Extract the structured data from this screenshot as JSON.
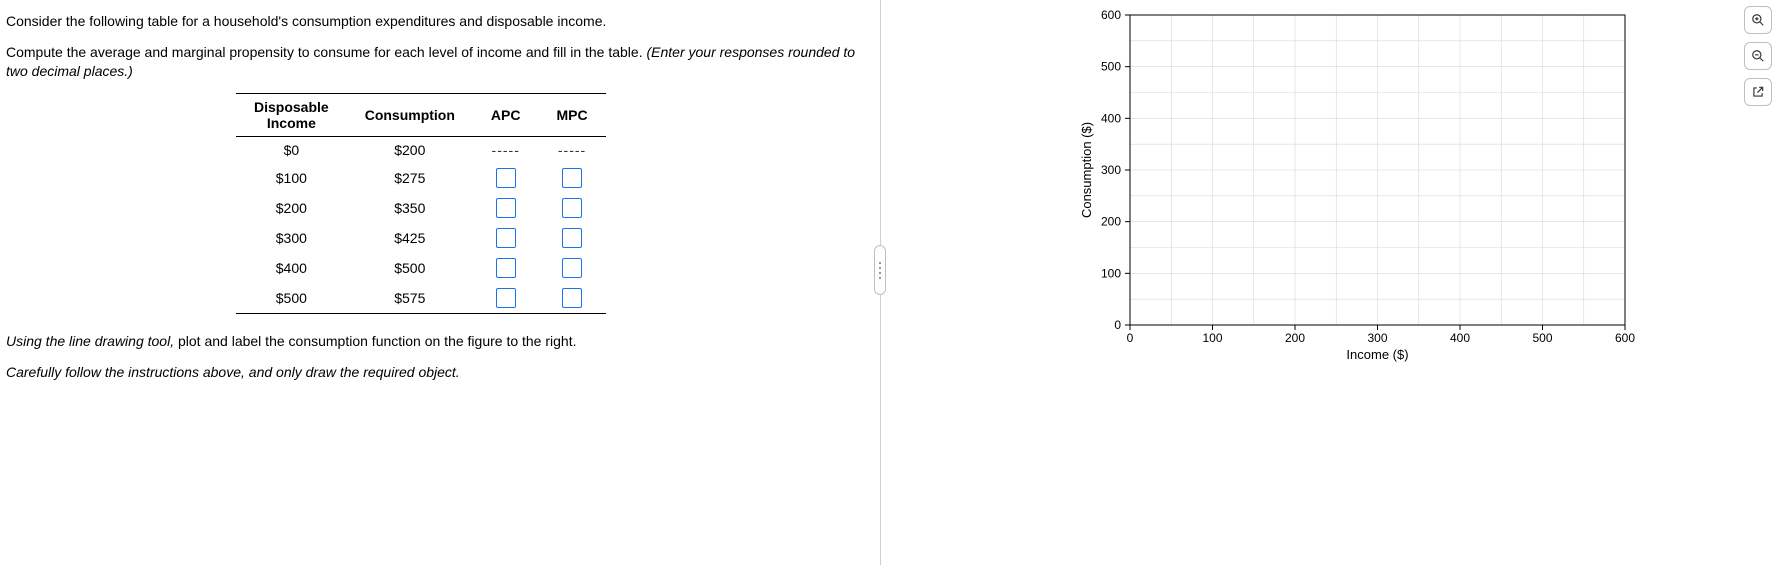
{
  "instructions": {
    "p1": "Consider the following table for a household's consumption expenditures and disposable income.",
    "p2a": "Compute the average and marginal propensity to consume for each level of income and fill in the table. ",
    "p2b": "(Enter your responses rounded to two decimal places.)",
    "p3a": "Using the line drawing tool,",
    "p3b": " plot and label the consumption function on the figure to the right.",
    "p4": "Carefully follow the instructions above, and only draw the required object."
  },
  "table": {
    "headers": {
      "c1a": "Disposable",
      "c1b": "Income",
      "c2": "Consumption",
      "c3": "APC",
      "c4": "MPC"
    },
    "rows": [
      {
        "income": "$0",
        "consumption": "$200",
        "apc_dash": true,
        "mpc_dash": true
      },
      {
        "income": "$100",
        "consumption": "$275",
        "apc_dash": false,
        "mpc_dash": false
      },
      {
        "income": "$200",
        "consumption": "$350",
        "apc_dash": false,
        "mpc_dash": false
      },
      {
        "income": "$300",
        "consumption": "$425",
        "apc_dash": false,
        "mpc_dash": false
      },
      {
        "income": "$400",
        "consumption": "$500",
        "apc_dash": false,
        "mpc_dash": false
      },
      {
        "income": "$500",
        "consumption": "$575",
        "apc_dash": false,
        "mpc_dash": false
      }
    ],
    "dash": "-----"
  },
  "chart_data": {
    "type": "scatter",
    "title": "",
    "xlabel": "Income ($)",
    "ylabel": "Consumption ($)",
    "xlim": [
      0,
      600
    ],
    "ylim": [
      0,
      600
    ],
    "xticks": [
      0,
      100,
      200,
      300,
      400,
      500,
      600
    ],
    "yticks": [
      0,
      100,
      200,
      300,
      400,
      500,
      600
    ],
    "x_minor": 50,
    "y_minor": 50,
    "grid": true,
    "series": []
  }
}
